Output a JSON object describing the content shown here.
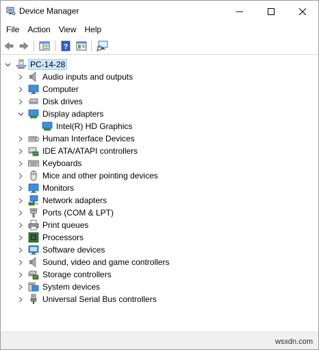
{
  "window": {
    "title": "Device Manager",
    "icons": {
      "app": "device-manager-icon",
      "minimize": "minimize-icon",
      "maximize": "maximize-icon",
      "close": "close-icon"
    }
  },
  "menu": {
    "file": "File",
    "action": "Action",
    "view": "View",
    "help": "Help"
  },
  "toolbar": {
    "buttons": [
      "back-arrow-icon",
      "forward-arrow-icon",
      "show-hide-console-tree-icon",
      "help-icon",
      "properties-icon",
      "scan-hardware-icon"
    ]
  },
  "tree": {
    "root": {
      "label": "PC-14-28",
      "expanded": true,
      "icon": "computer-icon"
    },
    "items": [
      {
        "label": "Audio inputs and outputs",
        "icon": "speaker-icon",
        "expanded": false
      },
      {
        "label": "Computer",
        "icon": "monitor-icon",
        "expanded": false
      },
      {
        "label": "Disk drives",
        "icon": "disk-drive-icon",
        "expanded": false
      },
      {
        "label": "Display adapters",
        "icon": "display-adapter-icon",
        "expanded": true,
        "children": [
          {
            "label": "Intel(R) HD Graphics",
            "icon": "display-adapter-icon"
          }
        ]
      },
      {
        "label": "Human Interface Devices",
        "icon": "hid-icon",
        "expanded": false
      },
      {
        "label": "IDE ATA/ATAPI controllers",
        "icon": "ide-controller-icon",
        "expanded": false
      },
      {
        "label": "Keyboards",
        "icon": "keyboard-icon",
        "expanded": false
      },
      {
        "label": "Mice and other pointing devices",
        "icon": "mouse-icon",
        "expanded": false
      },
      {
        "label": "Monitors",
        "icon": "monitor-icon",
        "expanded": false
      },
      {
        "label": "Network adapters",
        "icon": "network-adapter-icon",
        "expanded": false
      },
      {
        "label": "Ports (COM & LPT)",
        "icon": "port-icon",
        "expanded": false
      },
      {
        "label": "Print queues",
        "icon": "printer-icon",
        "expanded": false
      },
      {
        "label": "Processors",
        "icon": "processor-icon",
        "expanded": false
      },
      {
        "label": "Software devices",
        "icon": "software-device-icon",
        "expanded": false
      },
      {
        "label": "Sound, video and game controllers",
        "icon": "speaker-icon",
        "expanded": false
      },
      {
        "label": "Storage controllers",
        "icon": "storage-controller-icon",
        "expanded": false
      },
      {
        "label": "System devices",
        "icon": "system-device-icon",
        "expanded": false
      },
      {
        "label": "Universal Serial Bus controllers",
        "icon": "usb-icon",
        "expanded": false
      }
    ]
  },
  "status": {
    "watermark": "wsxdn.com"
  },
  "colors": {
    "selection_bg": "#cce8ff",
    "selection_border": "#99d1ff",
    "icon_blue": "#2b7bd2"
  }
}
